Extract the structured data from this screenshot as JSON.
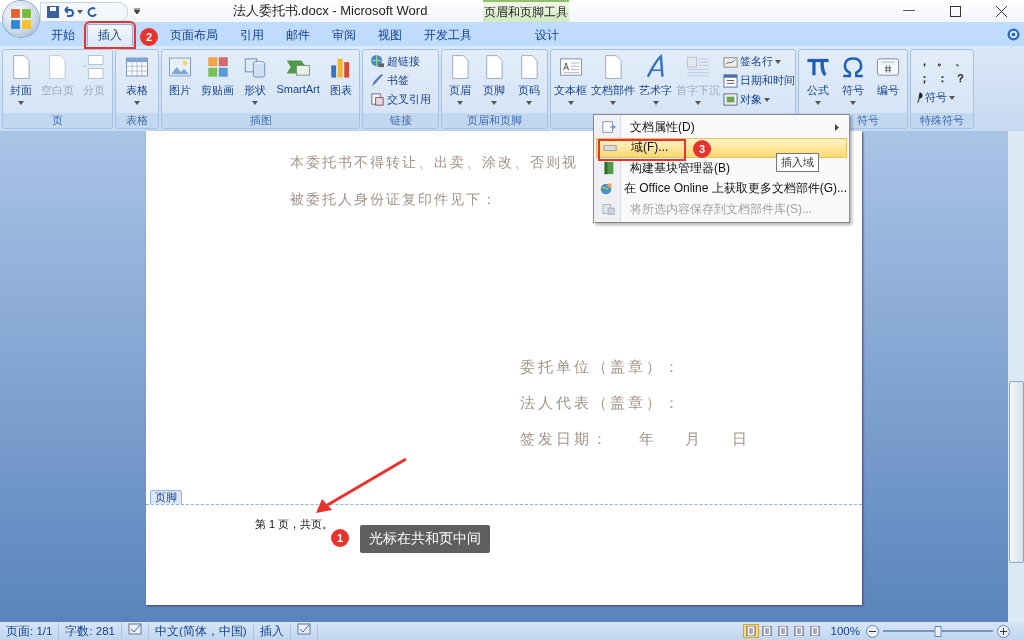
{
  "title_bar": {
    "title": "法人委托书.docx - Microsoft Word",
    "contextual_group": "页眉和页脚工具"
  },
  "tabs": [
    {
      "label": "开始",
      "selected": false,
      "marked": false
    },
    {
      "label": "插入",
      "selected": true,
      "marked": true,
      "badge": "2"
    },
    {
      "label": "页面布局",
      "selected": false,
      "marked": false
    },
    {
      "label": "引用",
      "selected": false,
      "marked": false
    },
    {
      "label": "邮件",
      "selected": false,
      "marked": false
    },
    {
      "label": "审阅",
      "selected": false,
      "marked": false
    },
    {
      "label": "视图",
      "selected": false,
      "marked": false
    },
    {
      "label": "开发工具",
      "selected": false,
      "marked": false
    }
  ],
  "contextual_tabs": [
    {
      "label": "设计",
      "selected": false
    }
  ],
  "ribbon_groups": [
    {
      "label": "页",
      "items": [
        {
          "kind": "large",
          "label": "封面",
          "dropdown": true,
          "disabled": false
        },
        {
          "kind": "large",
          "label": "空白页",
          "dropdown": false,
          "disabled": true
        },
        {
          "kind": "large",
          "label": "分页",
          "dropdown": false,
          "disabled": true
        }
      ]
    },
    {
      "label": "表格",
      "items": [
        {
          "kind": "large",
          "label": "表格",
          "dropdown": true,
          "disabled": false
        }
      ]
    },
    {
      "label": "插图",
      "items": [
        {
          "kind": "large",
          "label": "图片",
          "dropdown": false,
          "disabled": false
        },
        {
          "kind": "large",
          "label": "剪贴画",
          "dropdown": false,
          "disabled": false
        },
        {
          "kind": "large",
          "label": "形状",
          "dropdown": true,
          "disabled": false
        },
        {
          "kind": "large",
          "label": "SmartArt",
          "dropdown": false,
          "disabled": false
        },
        {
          "kind": "large",
          "label": "图表",
          "dropdown": false,
          "disabled": false
        }
      ]
    },
    {
      "label": "链接",
      "items": [
        {
          "kind": "small",
          "label": "超链接",
          "dropdown": false
        },
        {
          "kind": "small",
          "label": "书签",
          "dropdown": false
        },
        {
          "kind": "small",
          "label": "交叉引用",
          "dropdown": false
        }
      ]
    },
    {
      "label": "页眉和页脚",
      "items": [
        {
          "kind": "large",
          "label": "页眉",
          "dropdown": true,
          "disabled": false
        },
        {
          "kind": "large",
          "label": "页脚",
          "dropdown": true,
          "disabled": false
        },
        {
          "kind": "large",
          "label": "页码",
          "dropdown": true,
          "disabled": false
        }
      ]
    },
    {
      "items": [
        {
          "kind": "large",
          "label": "文本框",
          "dropdown": true,
          "disabled": false
        },
        {
          "kind": "large",
          "label": "文档部件",
          "dropdown": true,
          "disabled": false
        },
        {
          "kind": "large",
          "label": "艺术字",
          "dropdown": true,
          "disabled": false
        },
        {
          "kind": "large",
          "label": "首字下沉",
          "dropdown": true,
          "disabled": true
        },
        {
          "kind": "small",
          "label": "签名行",
          "dropdown": true
        },
        {
          "kind": "small",
          "label": "日期和时间",
          "dropdown": false
        },
        {
          "kind": "small",
          "label": "对象",
          "dropdown": true
        }
      ]
    },
    {
      "label": "符号",
      "items": [
        {
          "kind": "large",
          "label": "公式",
          "dropdown": true,
          "disabled": false
        },
        {
          "kind": "large",
          "label": "符号",
          "dropdown": true,
          "disabled": false
        },
        {
          "kind": "large",
          "label": "编号",
          "dropdown": false,
          "disabled": false
        }
      ]
    },
    {
      "label": "特殊符号",
      "items": [
        {
          "kind": "symbols",
          "symbols": [
            "，",
            "。",
            "、",
            "；",
            "：",
            "？"
          ]
        },
        {
          "kind": "small",
          "label": "符号",
          "dropdown": true
        }
      ]
    }
  ],
  "menu": {
    "items": [
      {
        "label": "文档属性(D)",
        "submenu": true,
        "disabled": false,
        "selected": false
      },
      {
        "label": "域(F)...",
        "submenu": false,
        "disabled": false,
        "selected": true,
        "marked": true,
        "badge": "3"
      },
      {
        "label": "构建基块管理器(B)",
        "submenu": false,
        "disabled": false,
        "selected": false
      },
      {
        "label": "在 Office Online 上获取更多文档部件(G)...",
        "submenu": false,
        "disabled": false,
        "selected": false
      },
      {
        "label": "将所选内容保存到文档部件库(S)...",
        "submenu": false,
        "disabled": true,
        "selected": false
      }
    ],
    "tooltip": "插入域"
  },
  "document": {
    "body_lines": [
      "本委托书不得转让、出卖、涂改、否则视",
      "被委托人身份证复印件见下："
    ],
    "signature_lines": [
      "委托单位（盖章）：",
      "法人代表（盖章）：",
      "签发日期：    年    月    日"
    ],
    "footer_label": "页脚",
    "footer_text": "第 1 页，共页。",
    "callout": {
      "badge": "1",
      "text": "光标在共和页中间"
    }
  },
  "status_bar": {
    "items": [
      {
        "kind": "text",
        "text": "页面: 1/1"
      },
      {
        "kind": "text",
        "text": "字数: 281"
      },
      {
        "kind": "icon"
      },
      {
        "kind": "text",
        "text": "中文(简体，中国)"
      },
      {
        "kind": "text",
        "text": "插入"
      },
      {
        "kind": "icon"
      }
    ],
    "view_buttons": [
      {
        "selected": true
      },
      {
        "selected": false
      },
      {
        "selected": false
      },
      {
        "selected": false
      },
      {
        "selected": false
      }
    ],
    "zoom": {
      "reading": "100%",
      "level": 0.5
    }
  }
}
